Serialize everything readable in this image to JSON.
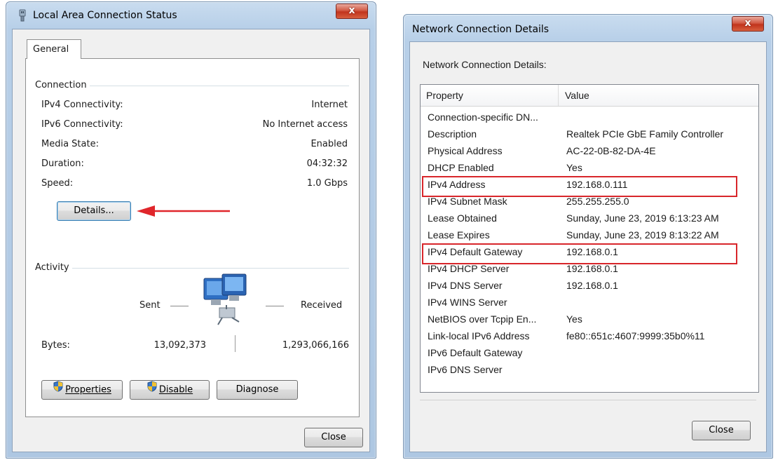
{
  "status_window": {
    "title": "Local Area Connection Status",
    "close_glyph": "x",
    "tab_general": "General",
    "connection": {
      "heading": "Connection",
      "rows": [
        {
          "label": "IPv4 Connectivity:",
          "value": "Internet"
        },
        {
          "label": "IPv6 Connectivity:",
          "value": "No Internet access"
        },
        {
          "label": "Media State:",
          "value": "Enabled"
        },
        {
          "label": "Duration:",
          "value": "04:32:32"
        },
        {
          "label": "Speed:",
          "value": "1.0 Gbps"
        }
      ],
      "details_button": "Details..."
    },
    "activity": {
      "heading": "Activity",
      "sent_label": "Sent",
      "received_label": "Received",
      "bytes_label": "Bytes:",
      "bytes_sent": "13,092,373",
      "bytes_received": "1,293,066,166",
      "network_icon": "network-computers-icon"
    },
    "buttons": {
      "properties": "Properties",
      "disable": "Disable",
      "diagnose": "Diagnose",
      "close": "Close"
    }
  },
  "details_window": {
    "title": "Network Connection Details",
    "close_glyph": "x",
    "subheading": "Network Connection Details:",
    "columns": {
      "property": "Property",
      "value": "Value"
    },
    "rows": [
      {
        "property": "Connection-specific DN...",
        "value": ""
      },
      {
        "property": "Description",
        "value": "Realtek PCIe GbE Family Controller"
      },
      {
        "property": "Physical Address",
        "value": "AC-22-0B-82-DA-4E"
      },
      {
        "property": "DHCP Enabled",
        "value": "Yes"
      },
      {
        "property": "IPv4 Address",
        "value": "192.168.0.111"
      },
      {
        "property": "IPv4 Subnet Mask",
        "value": "255.255.255.0"
      },
      {
        "property": "Lease Obtained",
        "value": "Sunday, June 23, 2019 6:13:23 AM"
      },
      {
        "property": "Lease Expires",
        "value": "Sunday, June 23, 2019 8:13:22 AM"
      },
      {
        "property": "IPv4 Default Gateway",
        "value": "192.168.0.1"
      },
      {
        "property": "IPv4 DHCP Server",
        "value": "192.168.0.1"
      },
      {
        "property": "IPv4 DNS Server",
        "value": "192.168.0.1"
      },
      {
        "property": "IPv4 WINS Server",
        "value": ""
      },
      {
        "property": "NetBIOS over Tcpip En...",
        "value": "Yes"
      },
      {
        "property": "Link-local IPv6 Address",
        "value": "fe80::651c:4607:9999:35b0%11"
      },
      {
        "property": "IPv6 Default Gateway",
        "value": ""
      },
      {
        "property": "IPv6 DNS Server",
        "value": ""
      }
    ],
    "close_button": "Close"
  },
  "colors": {
    "highlight_box": "#d8262b",
    "arrow": "#e0262b",
    "window_frame": "#b7cfe8"
  }
}
